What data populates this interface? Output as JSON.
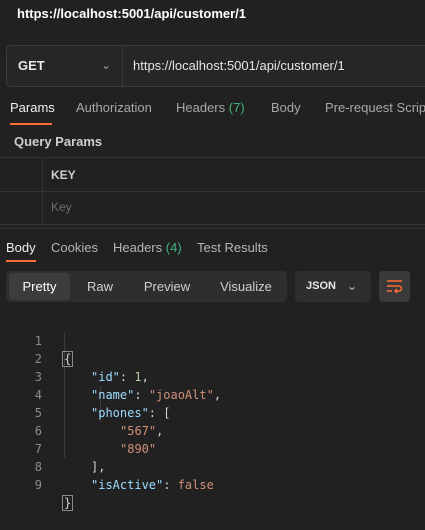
{
  "window_title": "https://localhost:5001/api/customer/1",
  "request": {
    "method": "GET",
    "url": "https://localhost:5001/api/customer/1"
  },
  "request_tabs": [
    {
      "label": "Params"
    },
    {
      "label": "Authorization"
    },
    {
      "label": "Headers",
      "count": "(7)"
    },
    {
      "label": "Body"
    },
    {
      "label": "Pre-request Script"
    }
  ],
  "query_params": {
    "title": "Query Params",
    "key_header": "KEY",
    "key_placeholder": "Key"
  },
  "response_tabs": [
    {
      "label": "Body"
    },
    {
      "label": "Cookies"
    },
    {
      "label": "Headers",
      "count": "(4)"
    },
    {
      "label": "Test Results"
    }
  ],
  "view_modes": [
    "Pretty",
    "Raw",
    "Preview",
    "Visualize"
  ],
  "format_select": "JSON",
  "line_numbers": [
    "1",
    "2",
    "3",
    "4",
    "5",
    "6",
    "7",
    "8",
    "9"
  ],
  "body": {
    "open_brace": "{",
    "id_key": "\"id\"",
    "id_value": "1",
    "name_key": "\"name\"",
    "name_value": "\"joaoAlt\"",
    "phones_key": "\"phones\"",
    "phone_1": "\"567\"",
    "phone_2": "\"890\"",
    "isActive_key": "\"isActive\"",
    "isActive_value": "false",
    "close_brace": "}"
  },
  "icons": [
    "chevron-down-icon",
    "wrap-lines-icon"
  ],
  "colors": {
    "accent": "#ff6c37",
    "count_green": "#3fb37a",
    "background": "#212121"
  }
}
